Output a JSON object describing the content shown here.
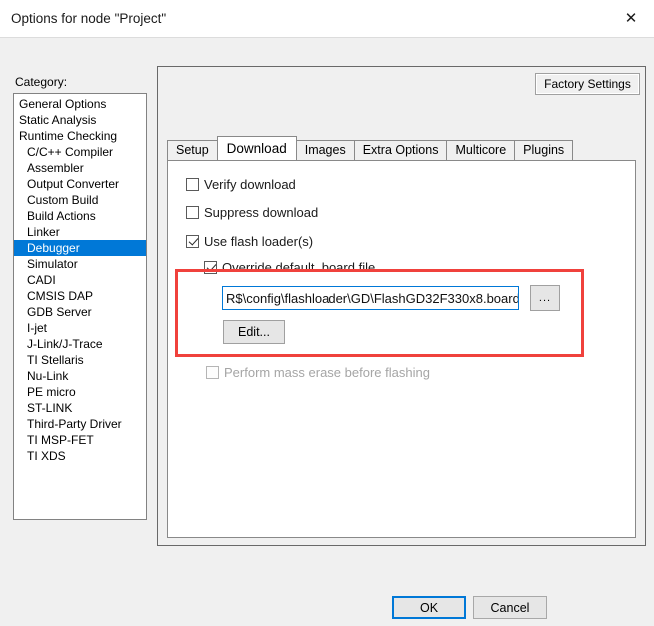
{
  "window": {
    "title": "Options for node \"Project\"",
    "close_icon": "close-icon",
    "close_glyph": "✕"
  },
  "category": {
    "label": "Category:",
    "selected": "Debugger",
    "items": [
      {
        "label": "General Options",
        "indent": false
      },
      {
        "label": "Static Analysis",
        "indent": false
      },
      {
        "label": "Runtime Checking",
        "indent": false
      },
      {
        "label": "C/C++ Compiler",
        "indent": true
      },
      {
        "label": "Assembler",
        "indent": true
      },
      {
        "label": "Output Converter",
        "indent": true
      },
      {
        "label": "Custom Build",
        "indent": true
      },
      {
        "label": "Build Actions",
        "indent": true
      },
      {
        "label": "Linker",
        "indent": true
      },
      {
        "label": "Debugger",
        "indent": true
      },
      {
        "label": "Simulator",
        "indent": true
      },
      {
        "label": "CADI",
        "indent": true
      },
      {
        "label": "CMSIS DAP",
        "indent": true
      },
      {
        "label": "GDB Server",
        "indent": true
      },
      {
        "label": "I-jet",
        "indent": true
      },
      {
        "label": "J-Link/J-Trace",
        "indent": true
      },
      {
        "label": "TI Stellaris",
        "indent": true
      },
      {
        "label": "Nu-Link",
        "indent": true
      },
      {
        "label": "PE micro",
        "indent": true
      },
      {
        "label": "ST-LINK",
        "indent": true
      },
      {
        "label": "Third-Party Driver",
        "indent": true
      },
      {
        "label": "TI MSP-FET",
        "indent": true
      },
      {
        "label": "TI XDS",
        "indent": true
      }
    ]
  },
  "panel": {
    "factory_settings_label": "Factory Settings",
    "tabs": [
      {
        "label": "Setup",
        "active": false
      },
      {
        "label": "Download",
        "active": true
      },
      {
        "label": "Images",
        "active": false
      },
      {
        "label": "Extra Options",
        "active": false
      },
      {
        "label": "Multicore",
        "active": false
      },
      {
        "label": "Plugins",
        "active": false
      }
    ]
  },
  "download_tab": {
    "verify_download": {
      "label": "Verify download",
      "checked": false,
      "disabled": false
    },
    "suppress_download": {
      "label": "Suppress download",
      "checked": false,
      "disabled": false
    },
    "use_flash_loader": {
      "label": "Use flash loader(s)",
      "checked": true,
      "disabled": false
    },
    "override_board_file": {
      "label": "Override default .board file",
      "checked": true,
      "disabled": false
    },
    "board_path": {
      "value_before_caret": "R$\\config\\flashloa",
      "value_after_caret": "der\\GD\\FlashGD32F330x8.board",
      "full_value": "R$\\config\\flashloader\\GD\\FlashGD32F330x8.board"
    },
    "browse_button_label": "...",
    "edit_button_label": "Edit...",
    "perform_mass_erase": {
      "label": "Perform mass erase before flashing",
      "checked": false,
      "disabled": true
    }
  },
  "footer": {
    "ok_label": "OK",
    "cancel_label": "Cancel"
  },
  "colors": {
    "selection": "#0078d7",
    "annotation": "#f0413c",
    "focus_border": "#0078d7"
  }
}
